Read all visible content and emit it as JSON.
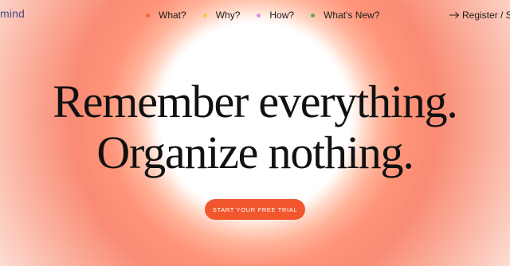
{
  "header": {
    "logo_text": "mind",
    "nav": [
      {
        "label": "What?",
        "dot_color": "#f5633b"
      },
      {
        "label": "Why?",
        "dot_color": "#f7c948"
      },
      {
        "label": "How?",
        "dot_color": "#e58be0"
      },
      {
        "label": "What's New?",
        "dot_color": "#5fa85a"
      }
    ],
    "register_label": "Register / S",
    "register_icon": "arrow-right-icon"
  },
  "hero": {
    "line1": "Remember everything.",
    "line2": "Organize nothing.",
    "cta_label": "START YOUR FREE TRIAL"
  },
  "colors": {
    "accent": "#f2562d",
    "logo": "#4a4d86",
    "text": "#111111"
  }
}
